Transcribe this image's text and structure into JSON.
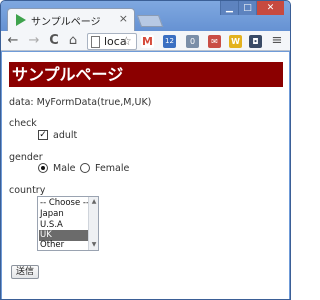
{
  "browser": {
    "tab_title": "サンプルページ",
    "tab_close": "×",
    "address_text": "loca",
    "window_minimize": "▁",
    "window_restore": "□",
    "window_close": "✕",
    "nav_back": "←",
    "nav_forward": "→",
    "nav_reload": "C",
    "nav_home": "⌂",
    "bookmark_star": "☆",
    "menu": "≡",
    "extensions": [
      {
        "icon": "gmail-icon",
        "label": "M",
        "color": "#d64a3a"
      },
      {
        "icon": "calendar-icon",
        "label": "12",
        "color": "#3a6fc2"
      },
      {
        "icon": "counter-icon",
        "label": "0",
        "color": "#7a8ea8"
      },
      {
        "icon": "mail-icon",
        "label": "✉",
        "color": "#c94d45"
      },
      {
        "icon": "w-icon",
        "label": "W",
        "color": "#e3b21f"
      },
      {
        "icon": "camera-icon",
        "label": "◘",
        "color": "#3a4b66"
      }
    ]
  },
  "page": {
    "heading": "サンプルページ",
    "data_line": "data: MyFormData(true,M,UK)",
    "check_label": "check",
    "adult_label": "adult",
    "adult_checked": true,
    "gender_label": "gender",
    "gender_options": [
      "Male",
      "Female"
    ],
    "gender_selected": "Male",
    "country_label": "country",
    "country_options": [
      "-- Choose --",
      "Japan",
      "U.S.A",
      "UK",
      "Other"
    ],
    "country_selected": "UK",
    "submit_label": "送信"
  }
}
